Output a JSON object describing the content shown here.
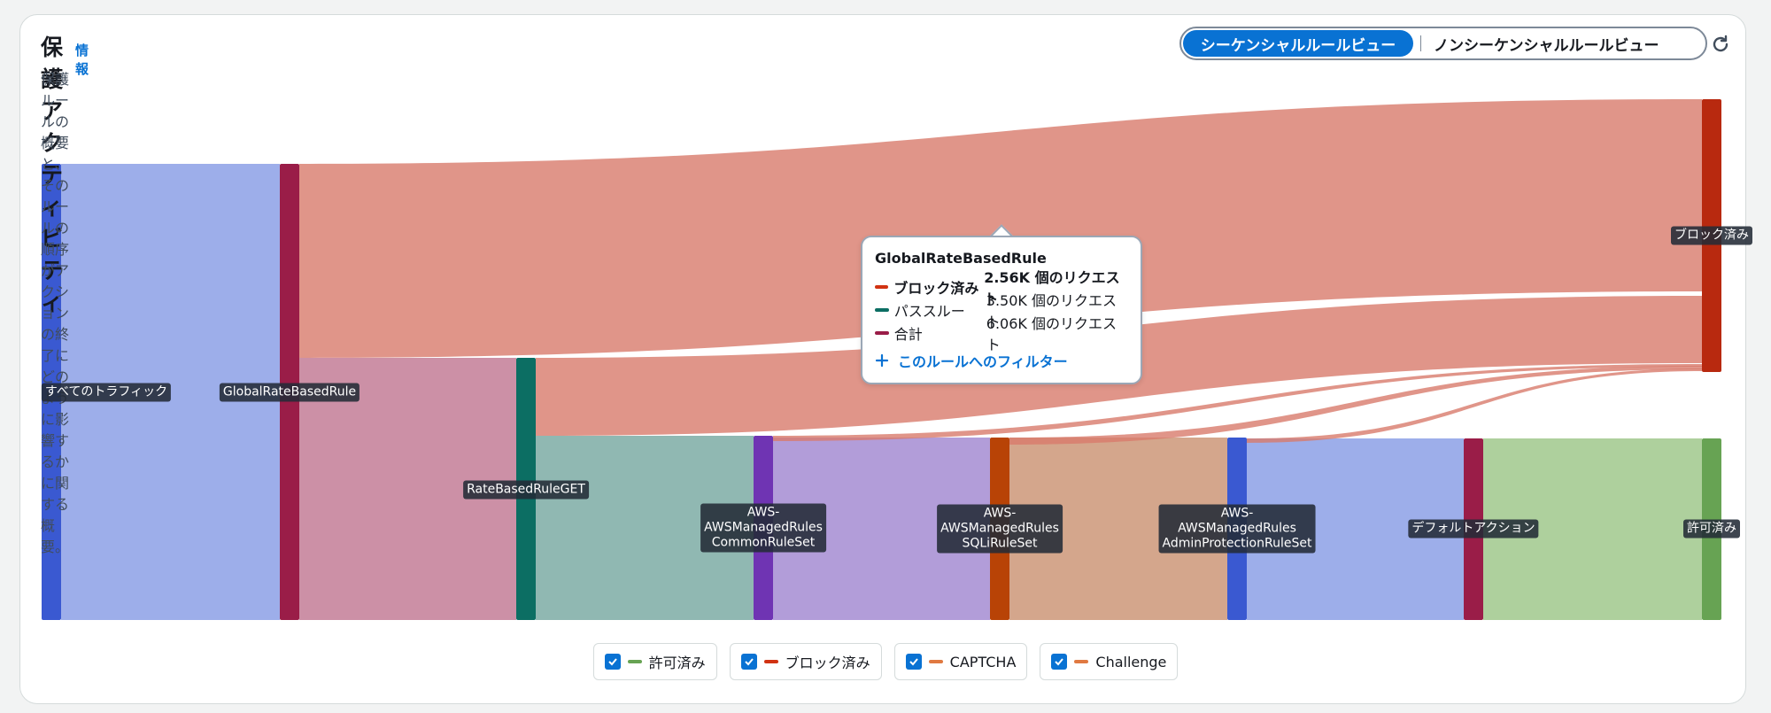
{
  "header": {
    "title": "保護アクティビティ",
    "info_link": "情報",
    "description": "保護ルールの概要と、そのルールの順序がアクションの終了にどのように影響するかに関する概要。"
  },
  "view_toggle": {
    "sequential": "シーケンシャルルールビュー",
    "non_sequential": "ノンシーケンシャルルールビュー",
    "selected": "sequential"
  },
  "refresh_icon": "refresh-icon",
  "nodes": [
    {
      "id": "all",
      "label": "すべてのトラフィック",
      "color": "#3a59d1"
    },
    {
      "id": "global",
      "label": "GlobalRateBasedRule",
      "color": "#9a1d48"
    },
    {
      "id": "rbget",
      "label": "RateBasedRuleGET",
      "color": "#0c6e63"
    },
    {
      "id": "common",
      "label": "AWS-\nAWSManagedRules\nCommonRuleSet",
      "color": "#6f34b3"
    },
    {
      "id": "sqli",
      "label": "AWS-\nAWSManagedRules\nSQLiRuleSet",
      "color": "#b84306"
    },
    {
      "id": "admin",
      "label": "AWS-\nAWSManagedRules\nAdminProtectionRuleSet",
      "color": "#3a59d1"
    },
    {
      "id": "default",
      "label": "デフォルトアクション",
      "color": "#9a1d48"
    },
    {
      "id": "allowed",
      "label": "許可済み",
      "color": "#67a353"
    },
    {
      "id": "blocked",
      "label": "ブロック済み",
      "color": "#b8290f"
    }
  ],
  "tooltip": {
    "rule": "GlobalRateBasedRule",
    "rows": [
      {
        "name": "ブロック済み",
        "value": "2.56K 個のリクエスト",
        "color": "#d13212",
        "bold": true
      },
      {
        "name": "パススルー",
        "value": "3.50K 個のリクエスト",
        "color": "#0c6e63",
        "bold": false
      },
      {
        "name": "合計",
        "value": "6.06K 個のリクエスト",
        "color": "#9a1d48",
        "bold": false
      }
    ],
    "filter_label": "このルールへのフィルター"
  },
  "legend": [
    {
      "label": "許可済み",
      "color": "#67a353",
      "checked": true
    },
    {
      "label": "ブロック済み",
      "color": "#d13212",
      "checked": true
    },
    {
      "label": "CAPTCHA",
      "color": "#e07941",
      "checked": true
    },
    {
      "label": "Challenge",
      "color": "#e07941",
      "checked": true
    }
  ]
}
